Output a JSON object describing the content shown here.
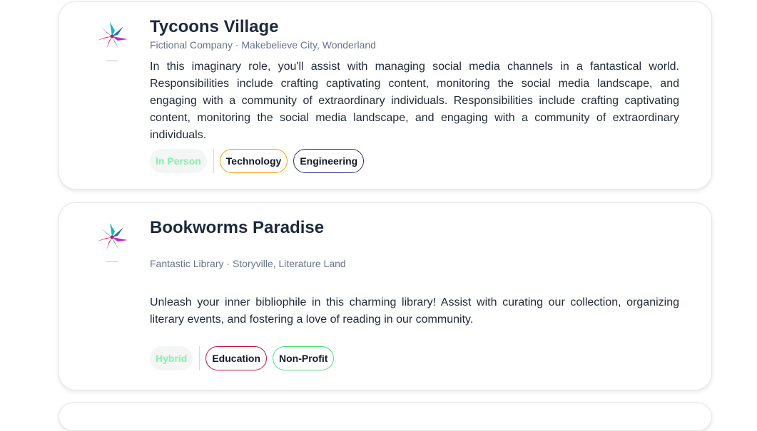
{
  "jobs": [
    {
      "title": "Tycoons Village",
      "company": "Fictional Company",
      "location": "Makebelieve City, Wonderland",
      "description": "In this imaginary role, you'll assist with managing social media channels in a fantastical world. Responsibilities include crafting captivating content, monitoring the social media landscape, and engaging with a community of extraordinary individuals. Responsibilities include crafting captivating content, monitoring the social media landscape, and engaging with a community of extraordinary individuals.",
      "work_mode": "In Person",
      "tags": [
        {
          "label": "Technology",
          "color": "#f59e0b"
        },
        {
          "label": "Engineering",
          "color": "#312e81"
        }
      ]
    },
    {
      "title": "Bookworms Paradise",
      "company": "Fantastic Library",
      "location": "Storyville, Literature Land",
      "description": "Unleash your inner bibliophile in this charming library! Assist with curating our collection, organizing literary events, and fostering a love of reading in our community.",
      "work_mode": "Hybrid",
      "tags": [
        {
          "label": "Education",
          "color": "#be123c"
        },
        {
          "label": "Non-Profit",
          "color": "#4ade80"
        }
      ]
    }
  ],
  "separator": " · ",
  "logo_icon": "pinwheel-logo-icon",
  "colors": {
    "title": "#1e293b",
    "subtitle": "#64748b",
    "work_mode_text": "#86efac"
  }
}
